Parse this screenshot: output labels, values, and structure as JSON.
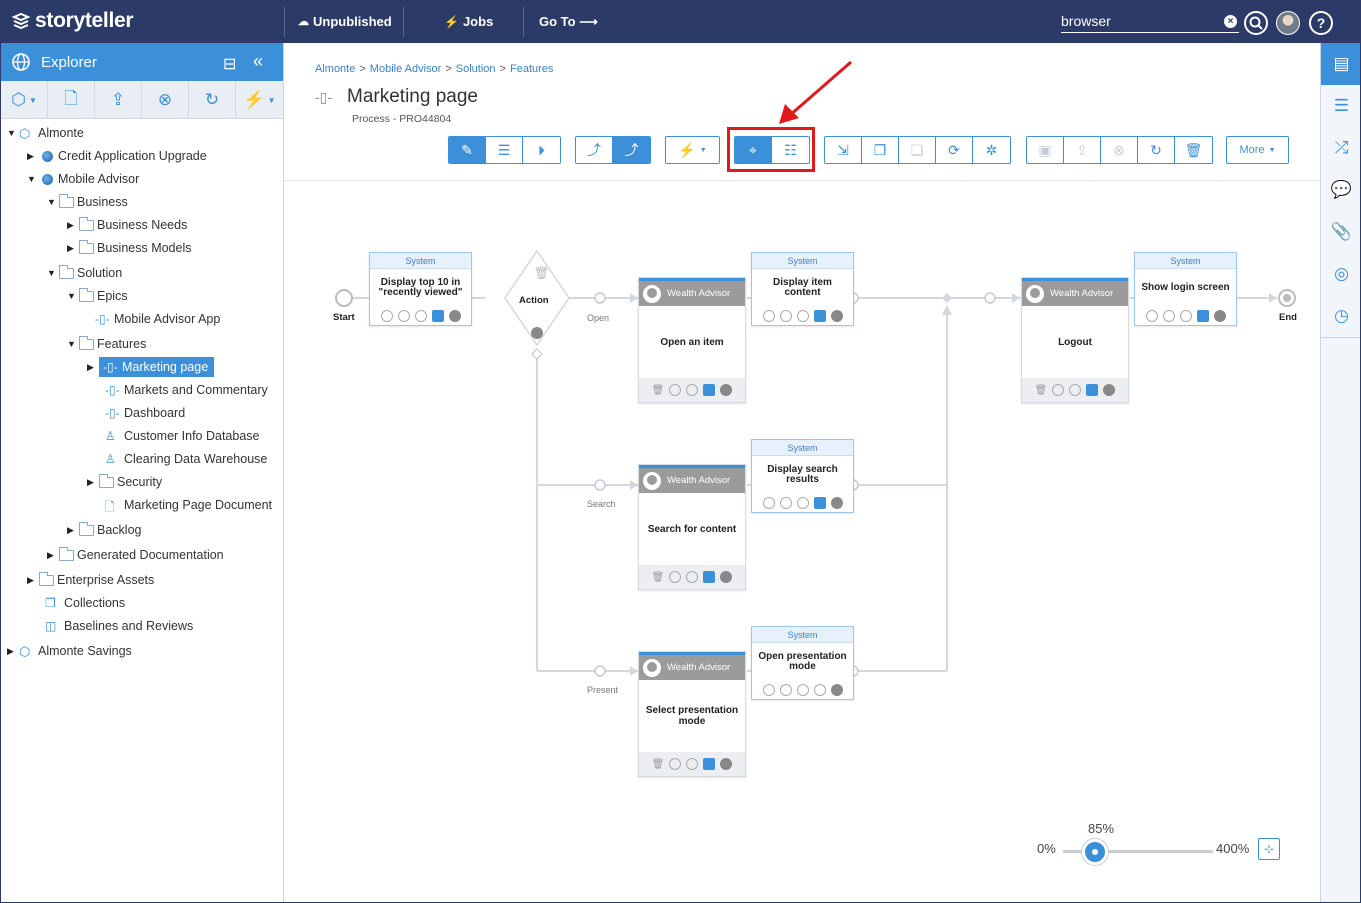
{
  "app": {
    "logo": "storyteller"
  },
  "topbar": {
    "unpublished": "Unpublished",
    "jobs": "Jobs",
    "goto": "Go To ⟶",
    "search_value": "browser",
    "help": "?"
  },
  "explorer": {
    "title": "Explorer",
    "tree": [
      {
        "label": "Almonte"
      },
      {
        "label": "Credit Application Upgrade"
      },
      {
        "label": "Mobile Advisor"
      },
      {
        "label": "Business"
      },
      {
        "label": "Business Needs"
      },
      {
        "label": "Business Models"
      },
      {
        "label": "Solution"
      },
      {
        "label": "Epics"
      },
      {
        "label": "Mobile Advisor App"
      },
      {
        "label": "Features"
      },
      {
        "label": "Marketing page"
      },
      {
        "label": "Markets and Commentary"
      },
      {
        "label": "Dashboard"
      },
      {
        "label": "Customer Info Database"
      },
      {
        "label": "Clearing Data Warehouse"
      },
      {
        "label": "Security"
      },
      {
        "label": "Marketing Page Document"
      },
      {
        "label": "Backlog"
      },
      {
        "label": "Generated Documentation"
      },
      {
        "label": "Enterprise Assets"
      },
      {
        "label": "Collections"
      },
      {
        "label": "Baselines and Reviews"
      },
      {
        "label": "Almonte Savings"
      }
    ]
  },
  "breadcrumbs": [
    "Almonte",
    "Mobile Advisor",
    "Solution",
    "Features"
  ],
  "page": {
    "title": "Marketing page",
    "subtitle": "Process - PRO44804"
  },
  "toolbar": {
    "more_label": "More"
  },
  "diagram": {
    "start_label": "Start",
    "end_label": "End",
    "decision_label": "Action",
    "flow_labels": {
      "open": "Open",
      "search": "Search",
      "present": "Present"
    },
    "actor": "Wealth Advisor",
    "system": "System",
    "user_tasks": [
      "Open an item",
      "Search for content",
      "Select presentation mode",
      "Logout"
    ],
    "system_tasks": [
      "Display top 10 in \"recently viewed\"",
      "Display item content",
      "Display search results",
      "Open presentation mode",
      "Show login screen"
    ]
  },
  "zoom": {
    "current": "85%",
    "min": "0%",
    "max": "400%",
    "level": 0.2125
  },
  "colors": {
    "brand": "#2b3a67",
    "accent": "#3b90d9",
    "highlight": "#e0191a"
  }
}
